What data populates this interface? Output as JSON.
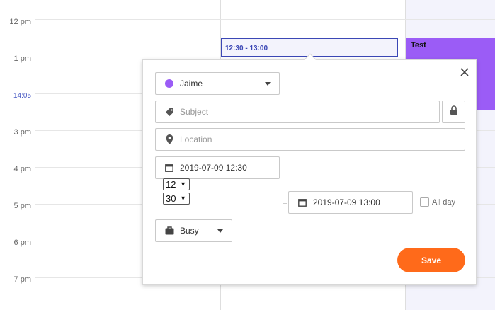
{
  "calendar": {
    "hours": [
      "12 pm",
      "1 pm",
      "3 pm",
      "4 pm",
      "5 pm",
      "6 pm",
      "7 pm"
    ],
    "now_label": "14:05",
    "selected_slot": "12:30 - 13:00",
    "events": [
      {
        "title": "Test",
        "color": "#9b5cf6"
      }
    ]
  },
  "popup": {
    "owner": {
      "name": "Jaime",
      "color": "#9b5cf6"
    },
    "subject": {
      "placeholder": "Subject",
      "value": ""
    },
    "location": {
      "placeholder": "Location",
      "value": ""
    },
    "start": {
      "value": "2019-07-09 12:30",
      "hour": "12",
      "minute": "30"
    },
    "end": {
      "value": "2019-07-09 13:00"
    },
    "all_day_label": "All day",
    "status": "Busy",
    "save_label": "Save",
    "close_icon": "close-icon",
    "accent_color": "#ff6a1a"
  }
}
